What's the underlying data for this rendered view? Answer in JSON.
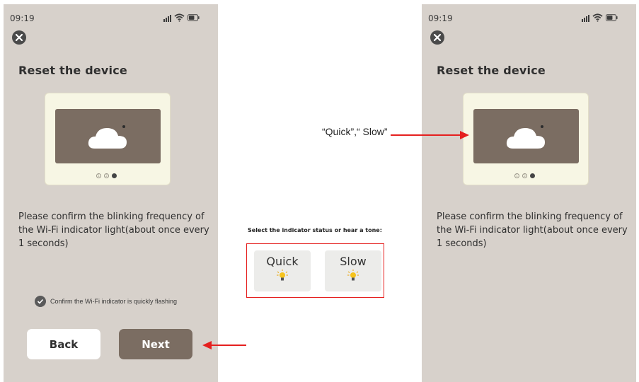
{
  "colors": {
    "phone_bg": "#d7d1cb",
    "primary_button": "#7b6d62",
    "annotation_red": "#e5201f",
    "card_bg": "#f7f6e4"
  },
  "left_phone": {
    "status_time": "09:19",
    "title": "Reset the device",
    "description": "Please confirm the blinking frequency of the Wi-Fi indicator light(about once every 1 seconds)",
    "confirm_text": "Confirm the Wi-Fi indicator is quickly flashing",
    "back_label": "Back",
    "next_label": "Next"
  },
  "right_phone": {
    "status_time": "09:19",
    "title": "Reset the device",
    "description": "Please confirm the blinking frequency of the Wi-Fi indicator light(about once every 1 seconds)"
  },
  "middle": {
    "instruction": "Select the indicator status or hear a tone:",
    "quick_label": "Quick",
    "slow_label": "Slow",
    "callout": "“Quick”,“ Slow”"
  },
  "icons": {
    "close": "close-icon",
    "signal": "signal-icon",
    "wifi": "wifi-icon",
    "battery": "battery-icon",
    "cloud": "cloud-icon",
    "bulb": "bulb-icon",
    "check": "check-icon"
  }
}
